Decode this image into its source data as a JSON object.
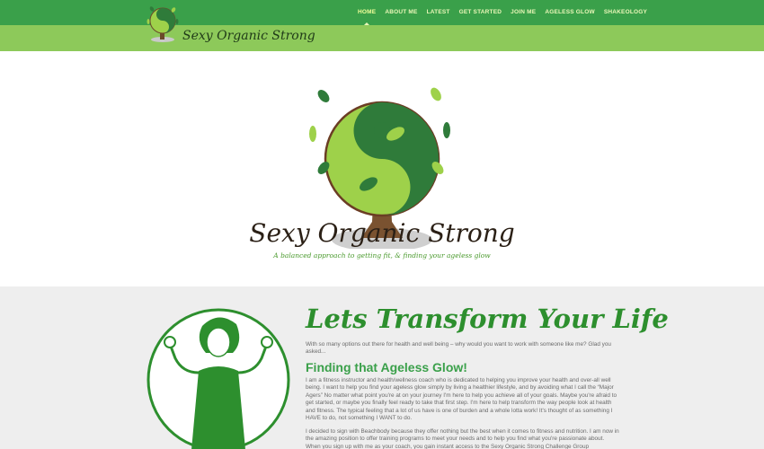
{
  "header": {
    "brand": "Sexy Organic Strong",
    "nav": [
      {
        "label": "HOME",
        "active": true
      },
      {
        "label": "ABOUT ME",
        "active": false
      },
      {
        "label": "LATEST",
        "active": false
      },
      {
        "label": "GET STARTED",
        "active": false
      },
      {
        "label": "JOIN ME",
        "active": false
      },
      {
        "label": "AGELESS GLOW",
        "active": false
      },
      {
        "label": "SHAKEOLOGY",
        "active": false
      }
    ],
    "social_icons": [
      "search-icon",
      "facebook-icon",
      "twitter-icon",
      "instagram-icon",
      "pinterest-icon",
      "snapchat-icon"
    ]
  },
  "hero": {
    "title": "Sexy Organic Strong",
    "tagline": "A balanced approach to getting fit, & finding your ageless glow"
  },
  "content": {
    "headline": "Lets Transform Your Life",
    "intro": "With so many options out there for health and well being – why would you want to work with someone like me? Glad you asked...",
    "subhead": "Finding that Ageless Glow!",
    "body1": "I am a fitness instructor and health/wellness coach who is dedicated to helping you improve your health and over-all well being. I want to help you find your ageless glow simply by living a healthier lifestyle, and by avoiding what I call the “Major Agers”  No matter what point you're at on your journey I'm here to help you achieve all of your goals. Maybe you're afraid to get started, or maybe you finally feel ready to take that first step.  I'm here to help transform the way people look at health and fitness.  The typical feeling that a lot of us have is one of burden and a whole lotta work!  It's thought of as something I HAVE to do, not something I WANT to do.",
    "body2": "I decided to sign with Beachbody because they offer nothing but the best when it comes to fitness and nutrition.  I am now in the amazing position to offer training programs to meet your needs and to help you find what you're passionate about.  When you sign up with me as your coach, you gain instant access to the Sexy Organic Strong Challenge Group"
  },
  "colors": {
    "topbar": "#3aa04a",
    "subbar": "#8dc95a",
    "accent": "#2d8f2e"
  }
}
